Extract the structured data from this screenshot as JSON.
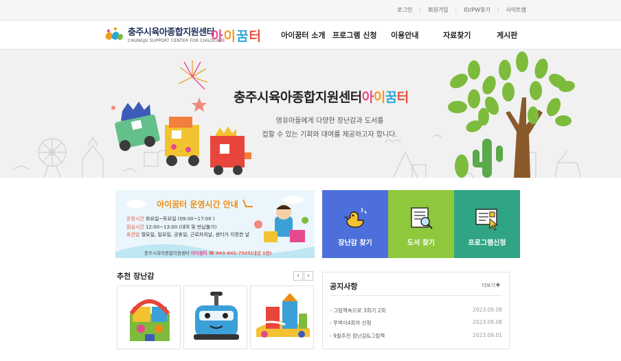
{
  "util": {
    "links": [
      "로그인",
      "회원가입",
      "ID/PW찾기",
      "사이트맵"
    ]
  },
  "header": {
    "org_name_ko": "충주시육아종합지원센터",
    "org_name_en": "CHUNGJU SUPPORT CENTER FOR CHILDCARE",
    "brand_chars": [
      "아",
      "이",
      "꿈",
      "터"
    ],
    "menu": [
      "아이꿈터 소개",
      "프로그램 신청",
      "이용안내",
      "자료찾기",
      "게시판"
    ]
  },
  "hero": {
    "title_prefix": "충주시육아종합지원센터",
    "title_brand": [
      "아",
      "이",
      "꿈",
      "터"
    ],
    "sub_line1": "영유아들에게 다양한 장난감과 도서를",
    "sub_line2": "접할 수 있는 기회와 대여를 제공하고자 합니다."
  },
  "banner": {
    "title": "아이꿈터 운영시간 안내",
    "rows": [
      {
        "key": "운영시간",
        "val": "화요일~토요일 (09:00~17:00 )"
      },
      {
        "key": "점심시간",
        "val": "12:00~13:00 (대여 및 반납불가)"
      },
      {
        "key": "휴관일",
        "val": "월요일, 일요일, 공휴일, 근로자의날, 센터가 지정한 날"
      }
    ],
    "foot_org": "충주시육아종합지원센터",
    "foot_brand": "아이꿈터",
    "foot_phone": "☎ 043-845-7505(내선 1번)"
  },
  "tiles": [
    {
      "label": "장난감 찾기",
      "color": "#4d6fdb"
    },
    {
      "label": "도서 찾기",
      "color": "#8fc83d"
    },
    {
      "label": "프로그램신청",
      "color": "#2fa585"
    }
  ],
  "recommend": {
    "title": "추천 장난감",
    "prev_glyph": "‹",
    "next_glyph": "›"
  },
  "notice": {
    "title": "공지사항",
    "more_label": "더보기",
    "more_glyph": "+",
    "items": [
      {
        "title": "- 그림책속으로 3회기 2회",
        "date": "2023.09.08"
      },
      {
        "title": "- 뚜벅이4회차 신청",
        "date": "2023.09.08"
      },
      {
        "title": "- 9월추천 장난감&그림책",
        "date": "2023.09.01"
      }
    ]
  },
  "colors": {
    "brand_pink": "#e64a8c",
    "brand_orange": "#f39c1f",
    "brand_blue": "#2aa8d8",
    "brand_red": "#e84c3d",
    "tree_green": "#7dbb3d"
  }
}
